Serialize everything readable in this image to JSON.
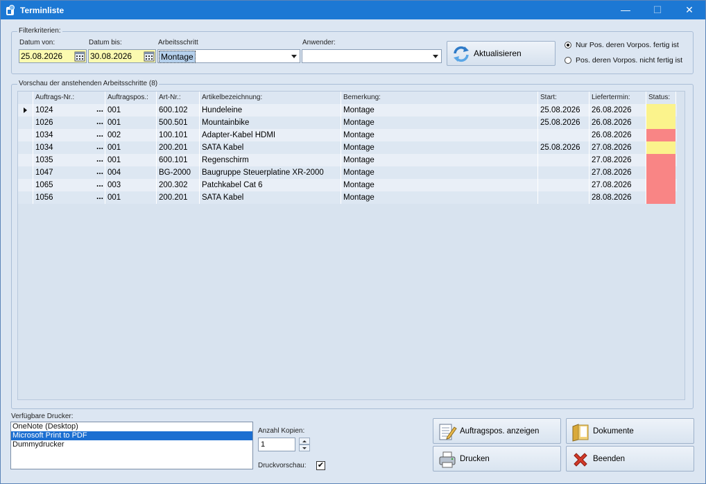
{
  "window": {
    "title": "Terminliste",
    "minimize": "—",
    "maximize": "☐",
    "close": "✕"
  },
  "filter": {
    "group_label": "Filterkriterien:",
    "date_from_label": "Datum von:",
    "date_from": "25.08.2026",
    "date_to_label": "Datum bis:",
    "date_to": "30.08.2026",
    "step_label": "Arbeitsschritt",
    "step_value": "Montage",
    "user_label": "Anwender:",
    "user_value": "",
    "refresh_label": "Aktualisieren",
    "radio_1": "Nur Pos. deren Vorpos. fertig ist",
    "radio_2": "Pos. deren Vorpos. nicht fertig ist",
    "radio_selected": 1
  },
  "preview": {
    "group_label": "Vorschau der anstehenden Arbeitsschritte (8)",
    "columns": [
      "Auftrags-Nr.:",
      "Auftragspos.:",
      "Art-Nr.:",
      "Artikelbezeichnung:",
      "Bemerkung:",
      "Start:",
      "Liefertermin:",
      "Status:"
    ],
    "rows": [
      {
        "order": "1024",
        "pos": "001",
        "art": "600.102",
        "desc": "Hundeleine",
        "note": "Montage",
        "start": "25.08.2026",
        "due": "26.08.2026",
        "status": "yellow"
      },
      {
        "order": "1026",
        "pos": "001",
        "art": "500.501",
        "desc": "Mountainbike",
        "note": "Montage",
        "start": "25.08.2026",
        "due": "26.08.2026",
        "status": "yellow"
      },
      {
        "order": "1034",
        "pos": "002",
        "art": "100.101",
        "desc": "Adapter-Kabel HDMI",
        "note": "Montage",
        "start": "",
        "due": "26.08.2026",
        "status": "red"
      },
      {
        "order": "1034",
        "pos": "001",
        "art": "200.201",
        "desc": "SATA Kabel",
        "note": "Montage",
        "start": "25.08.2026",
        "due": "27.08.2026",
        "status": "yellow"
      },
      {
        "order": "1035",
        "pos": "001",
        "art": "600.101",
        "desc": "Regenschirm",
        "note": "Montage",
        "start": "",
        "due": "27.08.2026",
        "status": "red"
      },
      {
        "order": "1047",
        "pos": "004",
        "art": "BG-2000",
        "desc": "Baugruppe Steuerplatine XR-2000",
        "note": "Montage",
        "start": "",
        "due": "27.08.2026",
        "status": "red"
      },
      {
        "order": "1065",
        "pos": "003",
        "art": "200.302",
        "desc": "Patchkabel Cat 6",
        "note": "Montage",
        "start": "",
        "due": "27.08.2026",
        "status": "red"
      },
      {
        "order": "1056",
        "pos": "001",
        "art": "200.201",
        "desc": "SATA Kabel",
        "note": "Montage",
        "start": "",
        "due": "28.08.2026",
        "status": "red"
      }
    ],
    "ellipsis": "...",
    "status_colors": {
      "yellow": "#fbf38c",
      "red": "#f98585"
    }
  },
  "printers": {
    "label": "Verfügbare Drucker:",
    "items": [
      "OneNote (Desktop)",
      "Microsoft Print to PDF",
      "Dummydrucker"
    ],
    "selected_index": 1
  },
  "copies": {
    "label": "Anzahl Kopien:",
    "value": "1"
  },
  "preview_option": {
    "label": "Druckvorschau:",
    "checked": true,
    "mark": "✔"
  },
  "buttons": {
    "show_positions": "Auftragspos. anzeigen",
    "documents": "Dokumente",
    "print": "Drucken",
    "exit": "Beenden"
  }
}
